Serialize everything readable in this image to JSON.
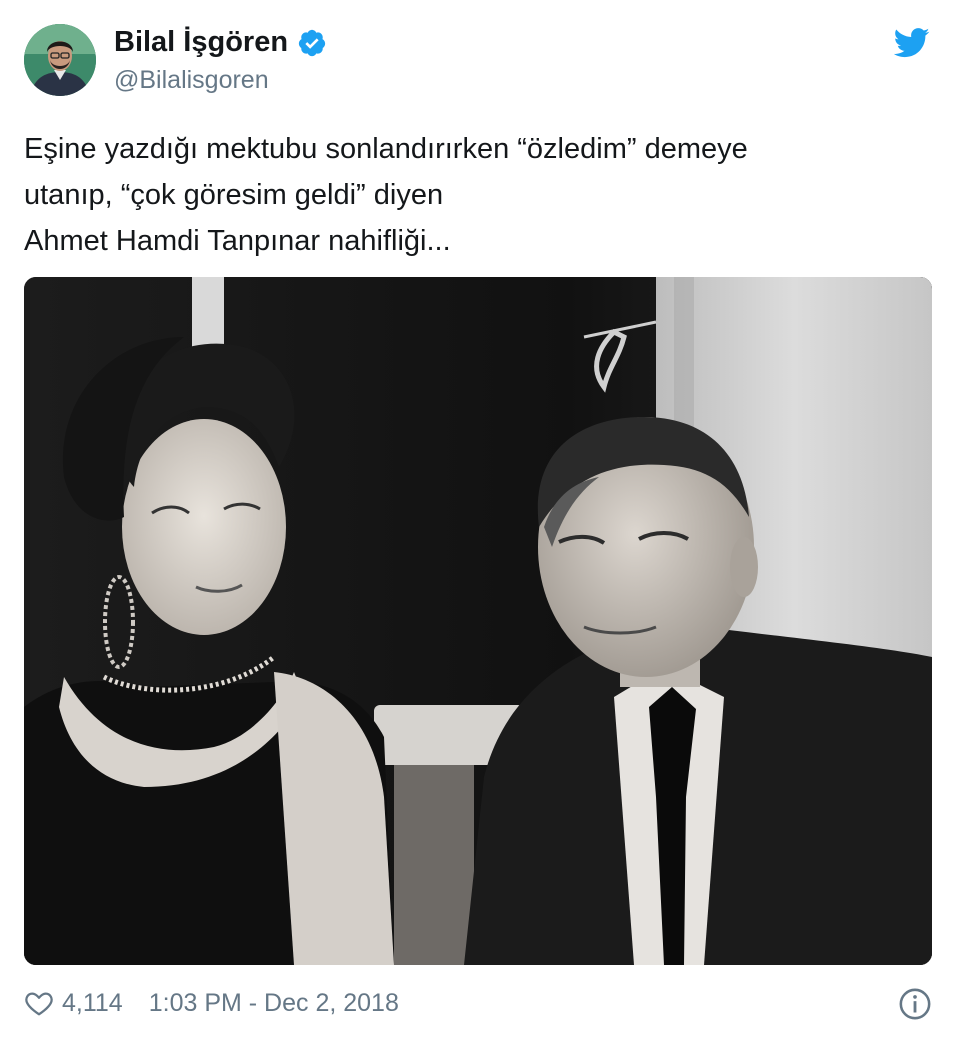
{
  "author": {
    "display_name": "Bilal İşgören",
    "handle": "@Bilalisgoren",
    "avatar_icon": "user-avatar",
    "verified_icon": "verified-badge-icon",
    "verified_color": "#1da1f2"
  },
  "brand": {
    "icon": "twitter-bird-icon",
    "color": "#1da1f2"
  },
  "tweet": {
    "text": "Eşine yazdığı mektubu sonlandırırken  “özledim” demeye\nutanıp, “çok göresim geldi” diyen\nAhmet Hamdi Tanpınar nahifliği...",
    "media_icon": "black-and-white-photo"
  },
  "footer": {
    "like_icon": "heart-icon",
    "likes": "4,114",
    "timestamp": "1:03 PM - Dec 2, 2018",
    "info_icon": "info-icon",
    "muted_color": "#657786"
  }
}
